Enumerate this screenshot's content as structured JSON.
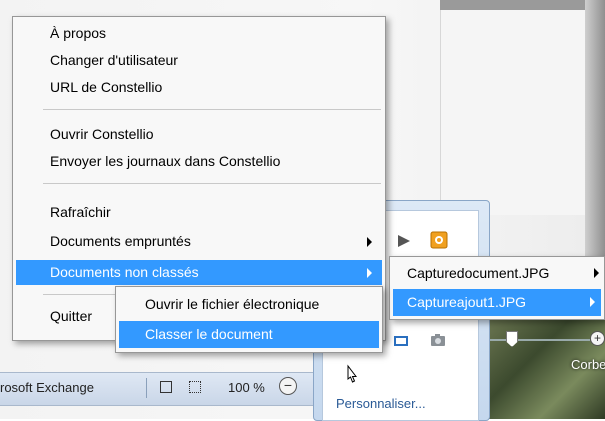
{
  "background": {
    "status_bar": {
      "app_text": "rosoft Exchange",
      "zoom": "100 %",
      "zoom_out_symbol": "−"
    },
    "start_flyout": {
      "personalize_label": "Personnaliser..."
    },
    "desktop_icon_label": "Corbe",
    "slider_plus_symbol": "+"
  },
  "main_menu": {
    "items": [
      {
        "label": "À propos"
      },
      {
        "label": "Changer d'utilisateur"
      },
      {
        "label": "URL de Constellio"
      },
      {
        "label": "Ouvrir Constellio"
      },
      {
        "label": "Envoyer les journaux dans Constellio"
      },
      {
        "label": "Rafraîchir"
      },
      {
        "label": "Documents empruntés"
      },
      {
        "label": "Documents non classés"
      },
      {
        "label": "Quitter"
      }
    ],
    "highlighted": "Documents non classés"
  },
  "documents_submenu": {
    "items": [
      {
        "label": "Capturedocument.JPG"
      },
      {
        "label": "Captureajout1.JPG"
      }
    ],
    "highlighted": "Captureajout1.JPG"
  },
  "file_actions_submenu": {
    "items": [
      {
        "label": "Ouvrir le fichier électronique"
      },
      {
        "label": "Classer le document"
      }
    ],
    "highlighted": "Classer le document"
  },
  "colors": {
    "highlight": "#3399ff",
    "menu_bg": "#f8f8f8"
  }
}
